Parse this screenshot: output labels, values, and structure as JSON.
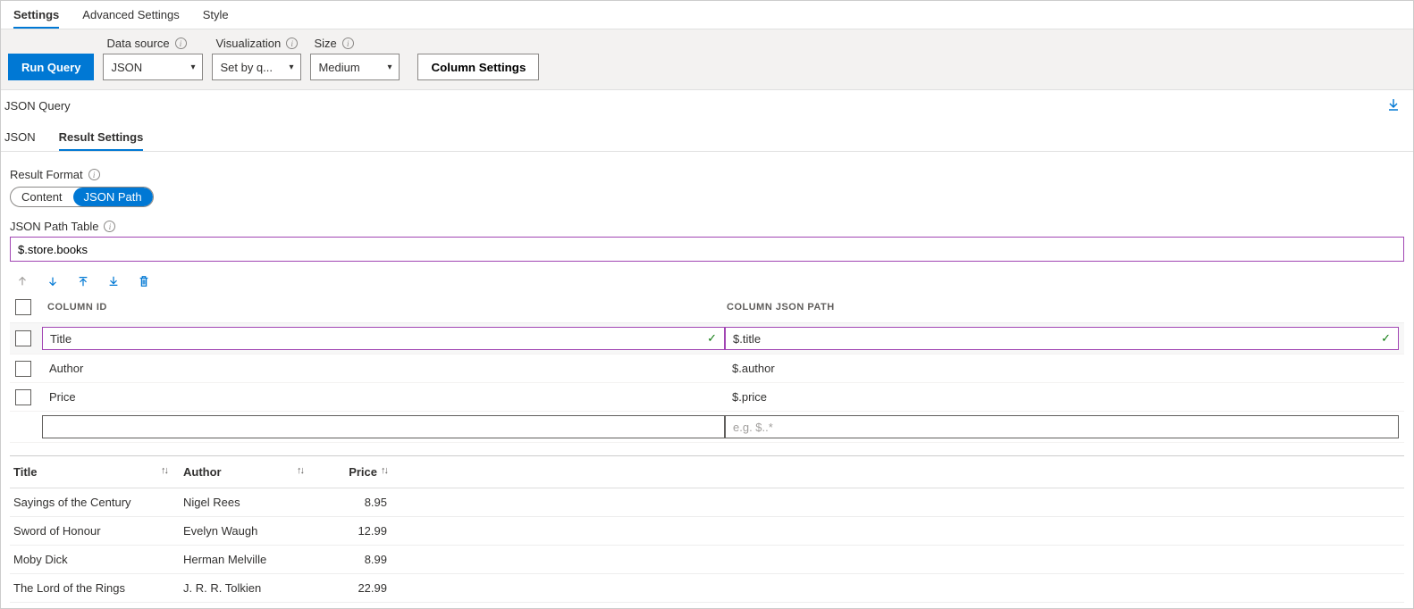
{
  "topTabs": [
    "Settings",
    "Advanced Settings",
    "Style"
  ],
  "toolbar": {
    "run": "Run Query",
    "dataSourceLabel": "Data source",
    "dataSourceValue": "JSON",
    "vizLabel": "Visualization",
    "vizValue": "Set by q...",
    "sizeLabel": "Size",
    "sizeValue": "Medium",
    "columnSettings": "Column Settings"
  },
  "section": {
    "title": "JSON Query"
  },
  "subTabs": [
    "JSON",
    "Result Settings"
  ],
  "resultFormat": {
    "label": "Result Format",
    "options": [
      "Content",
      "JSON Path"
    ]
  },
  "pathTable": {
    "label": "JSON Path Table",
    "value": "$.store.books"
  },
  "colDef": {
    "headers": {
      "id": "COLUMN ID",
      "path": "COLUMN JSON PATH"
    },
    "rows": [
      {
        "id": "Title",
        "path": "$.title",
        "validated": true
      },
      {
        "id": "Author",
        "path": "$.author",
        "validated": false
      },
      {
        "id": "Price",
        "path": "$.price",
        "validated": false
      }
    ],
    "new": {
      "idPlaceholder": "",
      "pathPlaceholder": "e.g. $..*"
    }
  },
  "results": {
    "headers": {
      "title": "Title",
      "author": "Author",
      "price": "Price"
    },
    "rows": [
      {
        "title": "Sayings of the Century",
        "author": "Nigel Rees",
        "price": "8.95"
      },
      {
        "title": "Sword of Honour",
        "author": "Evelyn Waugh",
        "price": "12.99"
      },
      {
        "title": "Moby Dick",
        "author": "Herman Melville",
        "price": "8.99"
      },
      {
        "title": "The Lord of the Rings",
        "author": "J. R. R. Tolkien",
        "price": "22.99"
      }
    ]
  }
}
